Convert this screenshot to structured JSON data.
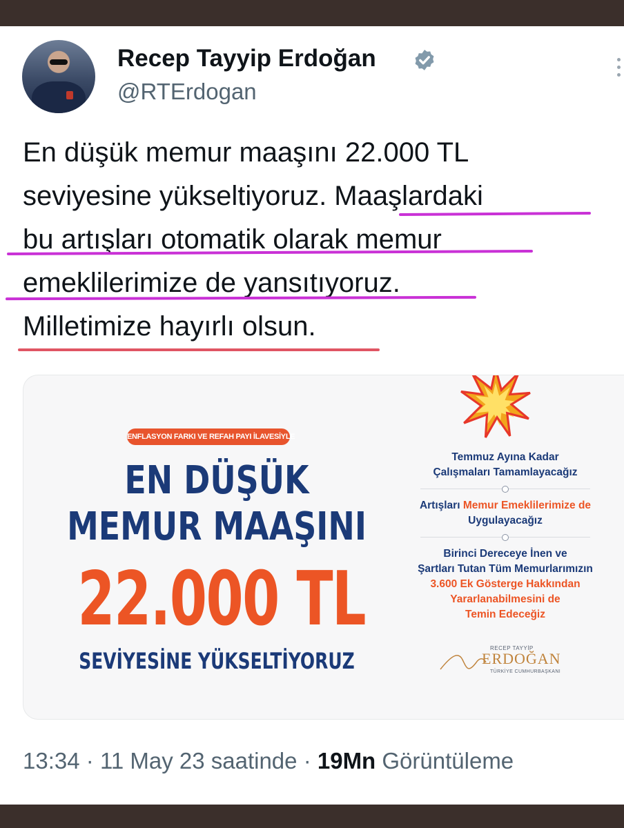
{
  "author": {
    "name": "Recep Tayyip Erdoğan",
    "handle": "@RTErdogan"
  },
  "tweet": {
    "lines": [
      "En düşük memur maaşını 22.000 TL",
      "seviyesine yükseltiyoruz. Maaşlardaki",
      "bu artışları otomatik olarak memur",
      "emeklilerimize de yansıtıyoruz.",
      "Milletimize hayırlı olsun."
    ]
  },
  "media": {
    "pill": "ENFLASYON FARKI VE REFAH PAYI İLAVESİYLE",
    "headline1": "EN DÜŞÜK",
    "headline2": "MEMUR MAAŞINI",
    "amount": "22.000 TL",
    "headline3": "SEVİYESİNE YÜKSELTİYORUZ",
    "items": [
      {
        "lines": [
          [
            "Temmuz Ayına Kadar",
            ""
          ],
          [
            "Çalışmaları Tamamlayacağız",
            ""
          ]
        ]
      },
      {
        "lines": [
          [
            "Artışları ",
            "Memur Emeklilerimize de"
          ],
          [
            "Uygulayacağız",
            ""
          ]
        ]
      },
      {
        "lines": [
          [
            "Birinci Dereceye İnen ve",
            ""
          ],
          [
            "Şartları Tutan Tüm Memurlarımızın",
            ""
          ],
          [
            "",
            "3.600 Ek Gösterge Hakkından"
          ],
          [
            "",
            "Yararlanabilmesini de"
          ],
          [
            "",
            "Temin Edeceğiz"
          ]
        ]
      }
    ],
    "signature_top": "RECEP TAYYİP",
    "signature_name": "ERDOĞAN",
    "signature_title": "TÜRKİYE CUMHURBAŞKANI"
  },
  "meta": {
    "time": "13:34",
    "date": "11 May 23 saatinde",
    "views": "19Mn",
    "views_label": "Görüntüleme"
  },
  "colors": {
    "highlight_pink": "#c931d6",
    "highlight_red": "#e05563",
    "navy": "#1b3a78",
    "orange": "#ec5525",
    "verified": "#829aab"
  }
}
